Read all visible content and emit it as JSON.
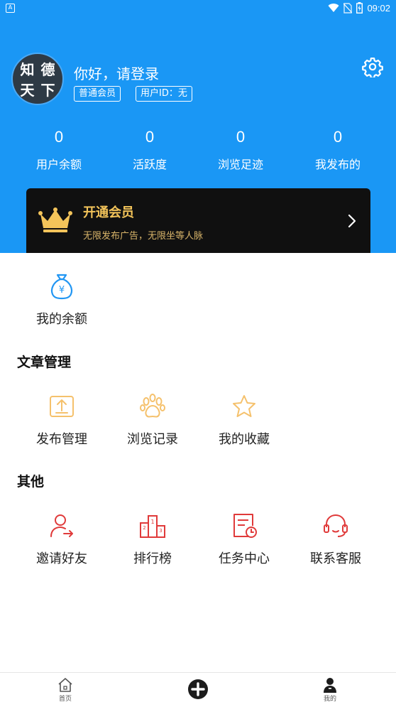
{
  "status_bar": {
    "left_icon": "A",
    "time": "09:02",
    "icons": [
      "wifi-icon",
      "no-sim-icon",
      "battery-icon"
    ]
  },
  "profile": {
    "avatar_chars": [
      "知",
      "德",
      "天",
      "下"
    ],
    "greeting": "你好，请登录",
    "member_tag": "普通会员",
    "uid_tag": "用户ID：无",
    "settings_icon": "gear-icon"
  },
  "stats": [
    {
      "value": "0",
      "label": "用户余额"
    },
    {
      "value": "0",
      "label": "活跃度"
    },
    {
      "value": "0",
      "label": "浏览足迹"
    },
    {
      "value": "0",
      "label": "我发布的"
    }
  ],
  "vip_banner": {
    "title": "开通会员",
    "subtitle": "无限发布广告，无限坐等人脉",
    "icon": "crown-icon"
  },
  "balance_item": {
    "label": "我的余额",
    "icon": "money-bag-icon"
  },
  "sections": {
    "articles": {
      "title": "文章管理",
      "items": [
        {
          "label": "发布管理",
          "icon": "upload-icon"
        },
        {
          "label": "浏览记录",
          "icon": "paw-icon"
        },
        {
          "label": "我的收藏",
          "icon": "star-icon"
        }
      ]
    },
    "other": {
      "title": "其他",
      "items": [
        {
          "label": "邀请好友",
          "icon": "invite-user-icon"
        },
        {
          "label": "排行榜",
          "icon": "podium-icon"
        },
        {
          "label": "任务中心",
          "icon": "task-icon"
        },
        {
          "label": "联系客服",
          "icon": "headset-icon"
        }
      ]
    }
  },
  "tabbar": [
    {
      "label": "首页",
      "icon": "home-icon"
    },
    {
      "label": "",
      "icon": "add-icon"
    },
    {
      "label": "我的",
      "icon": "user-icon"
    }
  ],
  "colors": {
    "header_bg": "#1a97f5",
    "vip_bg": "#101010",
    "vip_gold": "#f3c45a",
    "article_icon": "#f5c16c",
    "other_icon": "#e03a3a",
    "balance_icon": "#2196f3"
  }
}
